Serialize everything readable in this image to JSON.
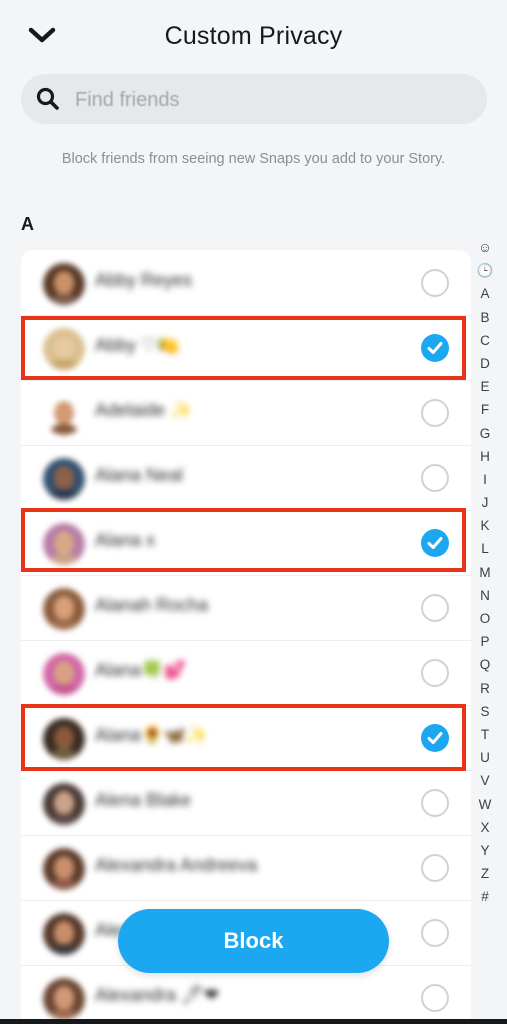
{
  "header": {
    "title": "Custom Privacy",
    "back_icon": "chevron-down-icon"
  },
  "search": {
    "placeholder": "Find friends",
    "value": "",
    "icon": "search-icon"
  },
  "description": "Block friends from seeing new Snaps you add to your Story.",
  "section": {
    "letter": "A"
  },
  "friends": [
    {
      "name": "Abby Reyes",
      "selected": false
    },
    {
      "name": "Abby ♡🍋",
      "selected": true
    },
    {
      "name": "Adelaide ✨",
      "selected": false
    },
    {
      "name": "Alana Neal",
      "selected": false
    },
    {
      "name": "Alana x",
      "selected": true
    },
    {
      "name": "Alanah Rocha",
      "selected": false
    },
    {
      "name": "Alana🍀💕",
      "selected": false
    },
    {
      "name": "Alana🌻🦋✨",
      "selected": true
    },
    {
      "name": "Alena Blake",
      "selected": false
    },
    {
      "name": "Alexandra Andreeva",
      "selected": false
    },
    {
      "name": "Alexandra",
      "selected": false
    },
    {
      "name": "Alexandra 🖊❤",
      "selected": false
    }
  ],
  "index": [
    "☺",
    "🕒",
    "A",
    "B",
    "C",
    "D",
    "E",
    "F",
    "G",
    "H",
    "I",
    "J",
    "K",
    "L",
    "M",
    "N",
    "O",
    "P",
    "Q",
    "R",
    "S",
    "T",
    "U",
    "V",
    "W",
    "X",
    "Y",
    "Z",
    "#"
  ],
  "action": {
    "block_label": "Block"
  },
  "colors": {
    "accent": "#1ca8f0",
    "highlight": "#e8351a",
    "background": "#f4f5f7"
  }
}
